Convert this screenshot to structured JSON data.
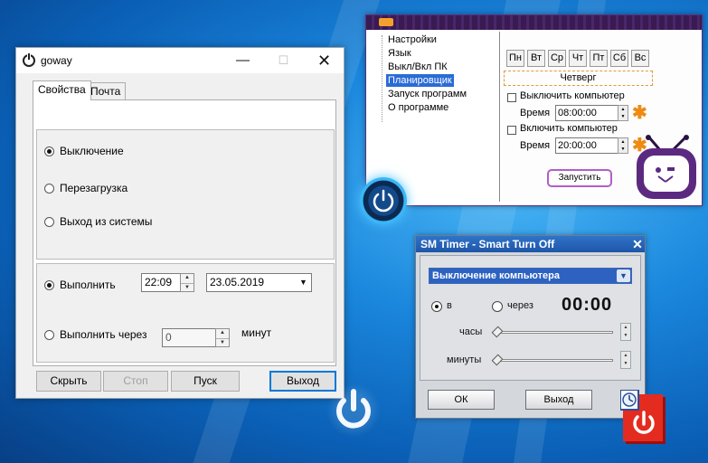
{
  "goway": {
    "title": "goway",
    "tabs": [
      {
        "label": "Свойства",
        "active": true
      },
      {
        "label": "Почта",
        "active": false
      }
    ],
    "options": {
      "shutdown": "Выключение",
      "restart": "Перезагрузка",
      "logout": "Выход из системы"
    },
    "execute_at": {
      "label": "Выполнить",
      "time": "22:09",
      "date": "23.05.2019"
    },
    "execute_after": {
      "label": "Выполнить через",
      "value": "0",
      "unit": "минут"
    },
    "buttons": {
      "hide": "Скрыть",
      "stop": "Стоп",
      "start": "Пуск",
      "exit": "Выход"
    }
  },
  "timepc": {
    "nav": [
      "Настройки",
      "Язык",
      "Выкл/Вкл ПК",
      "Планировщик",
      "Запуск программ",
      "О программе"
    ],
    "selected_nav": "Планировщик",
    "days": [
      "Пн",
      "Вт",
      "Ср",
      "Чт",
      "Пт",
      "Сб",
      "Вс"
    ],
    "day_name": "Четверг",
    "off": {
      "label": "Выключить компьютер",
      "time_label": "Время",
      "time": "08:00:00"
    },
    "on": {
      "label": "Включить компьютер",
      "time_label": "Время",
      "time": "20:00:00"
    },
    "run_button": "Запустить",
    "star": "✱"
  },
  "smtimer": {
    "title": "SM Timer - Smart Turn Off",
    "close": "✕",
    "action": "Выключение компьютера",
    "mode_at": "в",
    "mode_after": "через",
    "time": "00:00",
    "hours_label": "часы",
    "minutes_label": "минуты",
    "ok": "ОК",
    "exit": "Выход"
  },
  "window_icons": {
    "minimize": "—",
    "maximize": "☐",
    "close": "✕"
  },
  "colors": {
    "desktop": "#1a86dc",
    "timepc_title": "#3a1a52",
    "accent_orange": "#ef8a12",
    "smtimer_title": "#1f56a8",
    "selection": "#2a6bd6"
  }
}
